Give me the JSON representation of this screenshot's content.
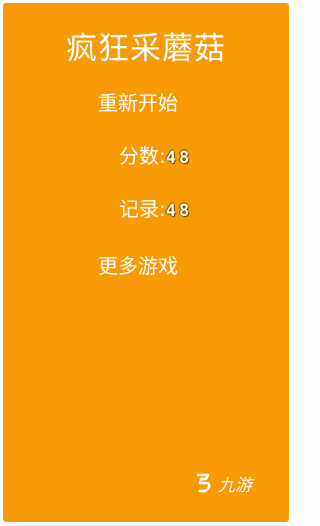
{
  "game": {
    "title": "疯狂采蘑菇",
    "menu": {
      "restart_label": "重新开始",
      "more_games_label": "更多游戏"
    },
    "stats": {
      "score_label": "分数:",
      "score_value": "48",
      "record_label": "记录:",
      "record_value": "48"
    }
  },
  "watermark": {
    "text": "九游",
    "icon": "jiuyou-logo-icon"
  },
  "colors": {
    "background": "#f89a06",
    "text": "#ffffff"
  }
}
